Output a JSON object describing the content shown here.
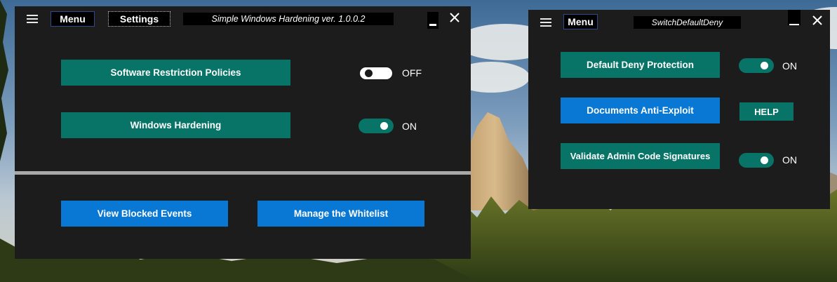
{
  "main_window": {
    "menu_label": "Menu",
    "settings_label": "Settings",
    "title": "Simple Windows Hardening ver. 1.0.0.2",
    "features": [
      {
        "label": "Software Restriction Policies",
        "state": "off",
        "state_label": "OFF"
      },
      {
        "label": "Windows Hardening",
        "state": "on",
        "state_label": "ON"
      }
    ],
    "bottom_buttons": {
      "view_events": "View Blocked Events",
      "whitelist": "Manage the Whitelist"
    }
  },
  "side_window": {
    "menu_label": "Menu",
    "title": "SwitchDefaultDeny",
    "default_deny": {
      "label": "Default Deny Protection",
      "state": "on",
      "state_label": "ON"
    },
    "anti_exploit": {
      "label": "Documents Anti-Exploit",
      "help_label": "HELP"
    },
    "validate_admin": {
      "label": "Validate Admin Code Signatures",
      "state": "on",
      "state_label": "ON"
    }
  },
  "colors": {
    "window_bg": "#1c1c1c",
    "teal": "#077467",
    "blue": "#0878d4",
    "divider": "#a8a8a8"
  },
  "icons": {
    "menu": "hamburger-icon",
    "minimize": "minimize-icon",
    "close": "close-icon",
    "toggle": "toggle-switch-icon"
  }
}
